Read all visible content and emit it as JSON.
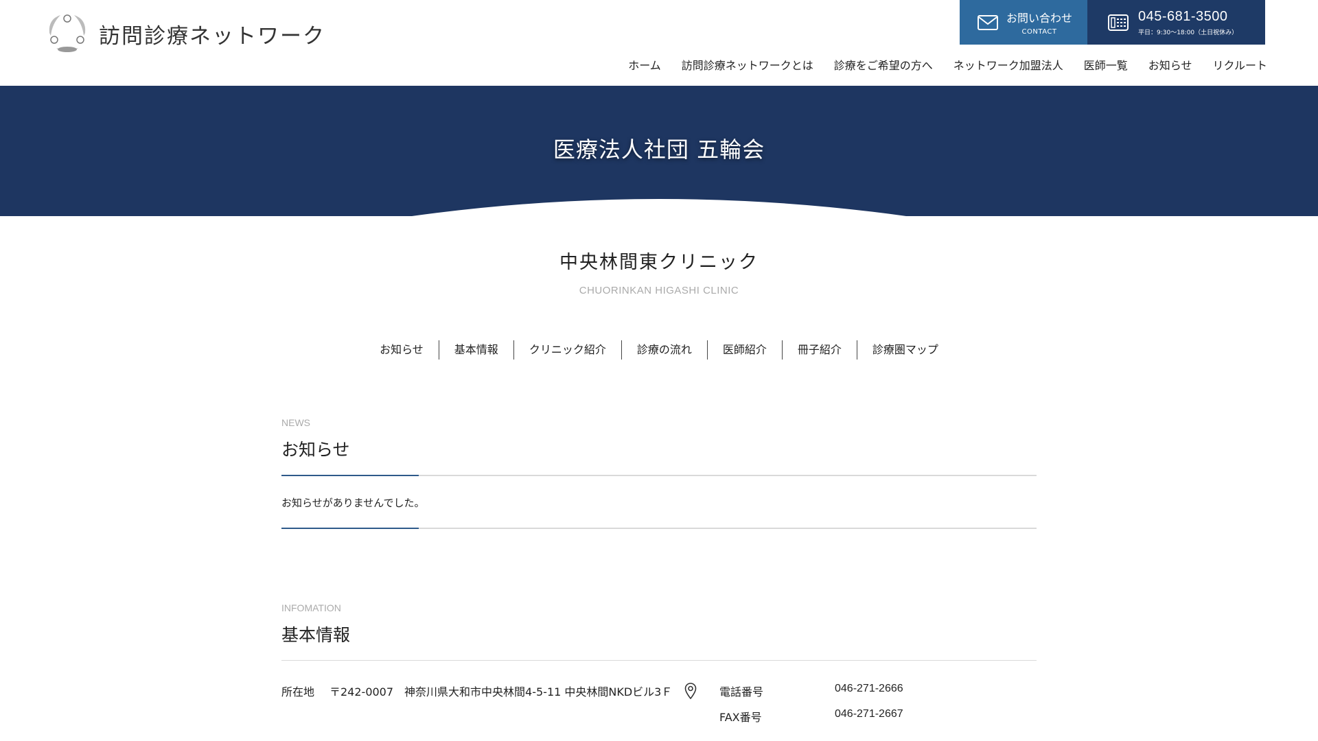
{
  "header": {
    "logo_text": "訪問診療ネットワーク",
    "contact": {
      "label": "お問い合わせ",
      "sub": "CONTACT"
    },
    "tel": {
      "number": "045-681-3500",
      "hours": "平日：9:30〜18:00（土日祝休み）"
    },
    "nav": [
      "ホーム",
      "訪問診療ネットワークとは",
      "診療をご希望の方へ",
      "ネットワーク加盟法人",
      "医師一覧",
      "お知らせ",
      "リクルート"
    ]
  },
  "hero": {
    "title": "医療法人社団 五輪会"
  },
  "clinic": {
    "name": "中央林間東クリニック",
    "name_en": "CHUORINKAN HIGASHI CLINIC",
    "subnav": [
      "お知らせ",
      "基本情報",
      "クリニック紹介",
      "診療の流れ",
      "医師紹介",
      "冊子紹介",
      "診療圏マップ"
    ]
  },
  "news": {
    "en": "NEWS",
    "title": "お知らせ",
    "empty_message": "お知らせがありませんでした。"
  },
  "info": {
    "en": "INFOMATION",
    "title": "基本情報",
    "address_label": "所在地",
    "address": "〒242-0007　神奈川県大和市中央林間4-5-11 中央林間NKDビル3Ｆ",
    "rows": [
      {
        "k": "電話番号",
        "v": "046-271-2666"
      },
      {
        "k": "FAX番号",
        "v": "046-271-2667"
      }
    ]
  },
  "colors": {
    "navy": "#1e3661",
    "contact_blue": "#2e6a9e",
    "tel_navy": "#1e3a66",
    "accent_rule": "#2e5a8a"
  }
}
